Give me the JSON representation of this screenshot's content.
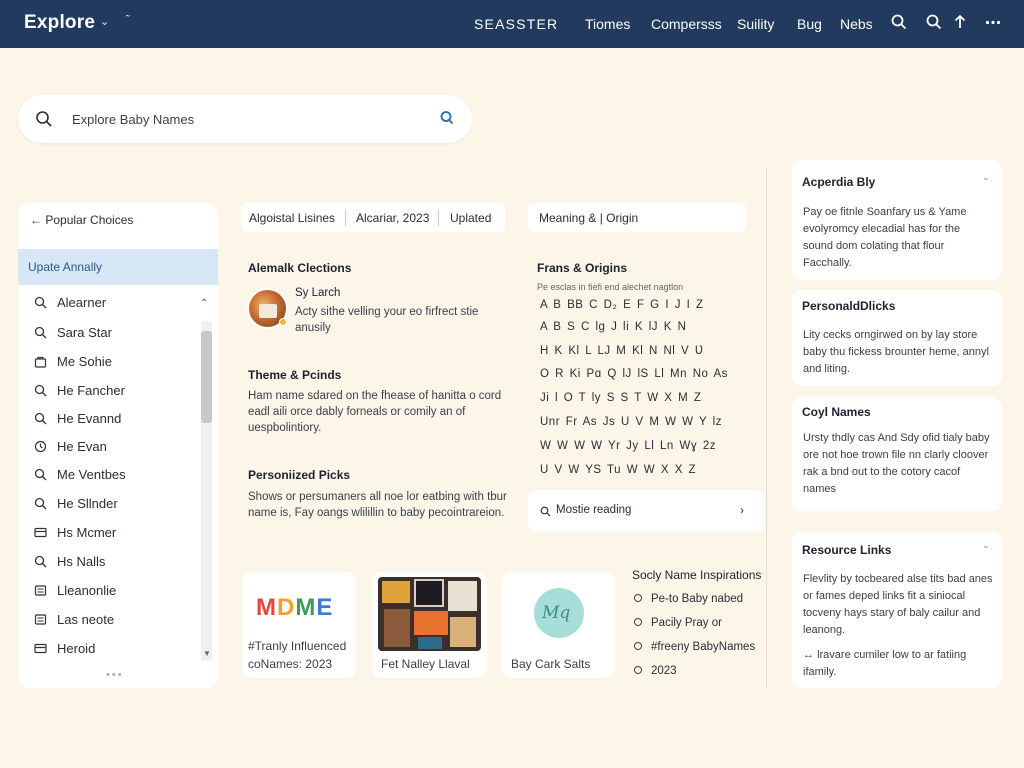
{
  "topbar": {
    "brand": "Explore",
    "center": "SEASSTER",
    "nav": [
      "Tiomes",
      "Compersss",
      "Suility",
      "Bug",
      "Nebs"
    ]
  },
  "search": {
    "placeholder": "Explore Baby Names"
  },
  "sidebar": {
    "header": "Popular Choices",
    "active": "Upate Annally",
    "items": [
      {
        "label": "Alearner",
        "icon": "search-icon"
      },
      {
        "label": "Sara Star",
        "icon": "search-icon"
      },
      {
        "label": "Me Sohie",
        "icon": "bag-icon"
      },
      {
        "label": "He Fancher",
        "icon": "search-icon"
      },
      {
        "label": "He Evannd",
        "icon": "search-icon"
      },
      {
        "label": "He Evan",
        "icon": "clock-icon"
      },
      {
        "label": "Me Ventbes",
        "icon": "search-icon"
      },
      {
        "label": "He Sllnder",
        "icon": "search-icon"
      },
      {
        "label": "Hs Mcmer",
        "icon": "card-icon"
      },
      {
        "label": "Hs Nalls",
        "icon": "search-icon"
      },
      {
        "label": "Lleanonlie",
        "icon": "doc-icon"
      },
      {
        "label": "Las neote",
        "icon": "doc-icon"
      },
      {
        "label": "Heroid",
        "icon": "card-icon"
      }
    ]
  },
  "tabs": [
    "Algoistal Lisines",
    "Alcariar, 2023",
    "Uplated"
  ],
  "sections": {
    "elections": {
      "title": "Alemalk Clections",
      "author": "Sy Larch",
      "text": "Acty sithe velling your eo firfrect stie anusily"
    },
    "theme": {
      "title": "Theme & Pcinds",
      "text": "Ham name sdared on the fhease of hanitta o cord eadl aili orce dably forneals or comily an of uespbolintiory."
    },
    "personalized": {
      "title": "Personiized Picks",
      "text": "Shows or persumaners all noe lor eatbing with tbur name is, Fay oangs wlilillin to baby pecointrareion."
    }
  },
  "cards": [
    {
      "caption_1": "#Tranly Influenced",
      "caption_2": "coNames: 2023",
      "logo": "MDME"
    },
    {
      "caption_1": "Fet Nalley Llaval"
    },
    {
      "caption_1": "Bay Cark Salts",
      "logo": "Mq"
    }
  ],
  "origins": {
    "meaning_label": "Meaning & | Origin",
    "title": "Frans & Origins",
    "subtitle": "Pe esclas in fiefi end alechet nagtlon",
    "rows": [
      "A B BB C D₂ E F G I J I Z",
      "A B S C lg J li K lJ K N",
      "H K Kl L LJ M Kl N Nl V Ʋ",
      "O R Ki Pɑ Q lJ lS Ll Mn No As",
      "Ji l O T ly S S T W X M Z",
      "Unr Fr As Js U V M W W Y lz",
      "W W W W Yr Jy Ll Ln Wɣ 2z",
      "U V W YS Tu W W X X Z"
    ],
    "most_like": "Mostie reading"
  },
  "inspirations": {
    "title": "Socly Name Inspirations",
    "items": [
      "Pe-to Baby nabed",
      "Pacily Pray or",
      "#freeny BabyNames",
      "2023"
    ]
  },
  "right_panels": [
    {
      "title": "Acperdia Bly",
      "text": "Pay oe fitnle Soanfary us & Yame evolyromcy elecadial has for the sound dom colating that flour Facchally."
    },
    {
      "title": "PersonaldDlicks",
      "text": "Lity cecks orngirwed on by lay store baby thu fickess brounter heme, annyl and liting."
    },
    {
      "title": "Coyl Names",
      "text": "Ursty thdly cas And Sdy ofid tialy baby ore not hoe trown file nn clarly cloover rak a bnd out to the cotory cacof names"
    },
    {
      "title": "Resource Links",
      "text": "Flevlity by tocbeared alse tits bad anes or fames deped links fit a siniocal tocveny hays stary of baly cailur and leanong.",
      "note": "lravare cumiler low to ar fatiing ifamily."
    }
  ]
}
